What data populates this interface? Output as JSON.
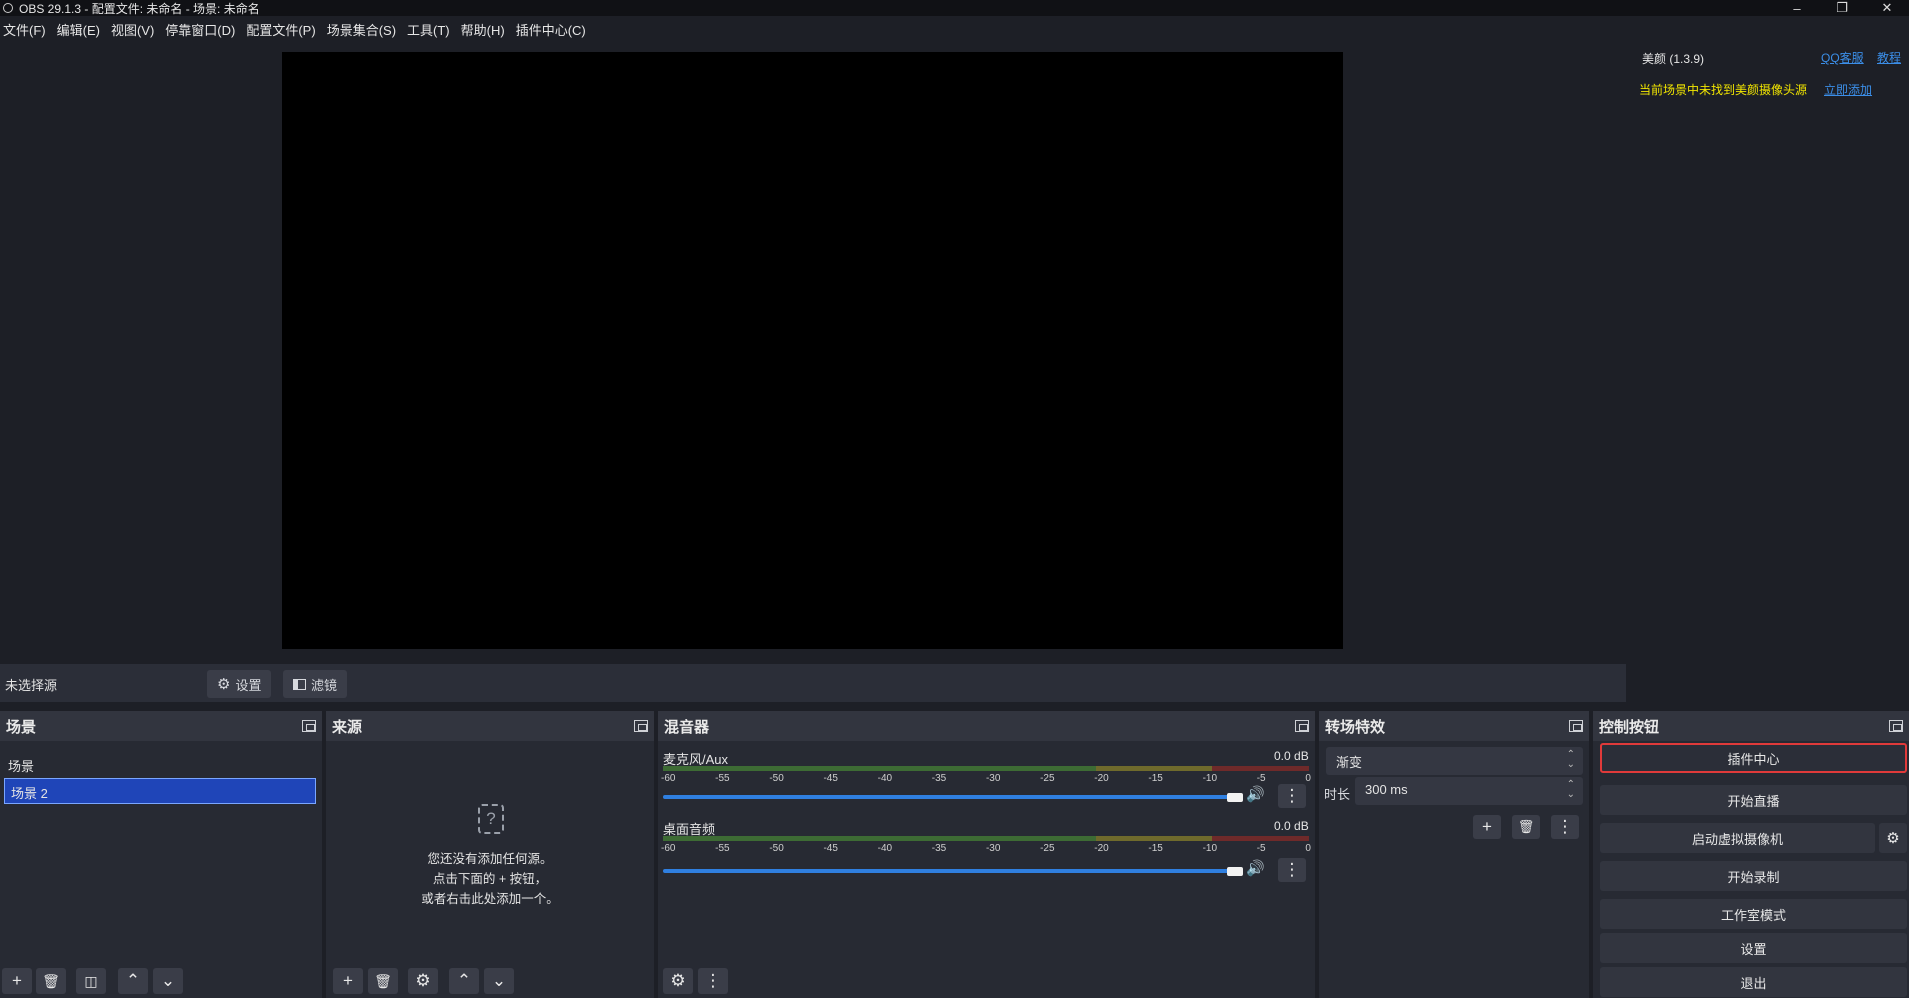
{
  "window": {
    "title": "OBS 29.1.3 - 配置文件: 未命名 - 场景: 未命名"
  },
  "menu": [
    "文件(F)",
    "编辑(E)",
    "视图(V)",
    "停靠窗口(D)",
    "配置文件(P)",
    "场景集合(S)",
    "工具(T)",
    "帮助(H)",
    "插件中心(C)"
  ],
  "beauty": {
    "title": "美颜 (1.3.9)",
    "link_qq": "QQ客服",
    "link_tutorial": "教程",
    "warning": "当前场景中未找到美颜摄像头源",
    "warning_link": "立即添加"
  },
  "source_bar": {
    "no_source": "未选择源",
    "settings": "设置",
    "filters": "滤镜"
  },
  "scenes": {
    "title": "场景",
    "items": [
      "场景",
      "场景 2"
    ],
    "selected": "场景 2"
  },
  "sources": {
    "title": "来源",
    "empty_lines": [
      "您还没有添加任何源。",
      "点击下面的 + 按钮，",
      "或者右击此处添加一个。"
    ]
  },
  "mixer": {
    "title": "混音器",
    "channels": [
      {
        "name": "麦克风/Aux",
        "db": "0.0 dB",
        "level": 1.0
      },
      {
        "name": "桌面音频",
        "db": "0.0 dB",
        "level": 1.0
      }
    ],
    "ticks": [
      "-60",
      "-55",
      "-50",
      "-45",
      "-40",
      "-35",
      "-30",
      "-25",
      "-20",
      "-15",
      "-10",
      "-5",
      "0"
    ]
  },
  "transitions": {
    "title": "转场特效",
    "type": "渐变",
    "duration_label": "时长",
    "duration": "300 ms"
  },
  "controls": {
    "title": "控制按钮",
    "buttons": [
      "插件中心",
      "开始直播",
      "启动虚拟摄像机",
      "开始录制",
      "工作室模式",
      "设置",
      "退出"
    ],
    "highlight_color": "#e03a3a"
  },
  "colors": {
    "accent": "#2f7fe0",
    "selected_scene": "#1f45b8",
    "warning": "#f2e600",
    "link": "#3b8ee8"
  }
}
